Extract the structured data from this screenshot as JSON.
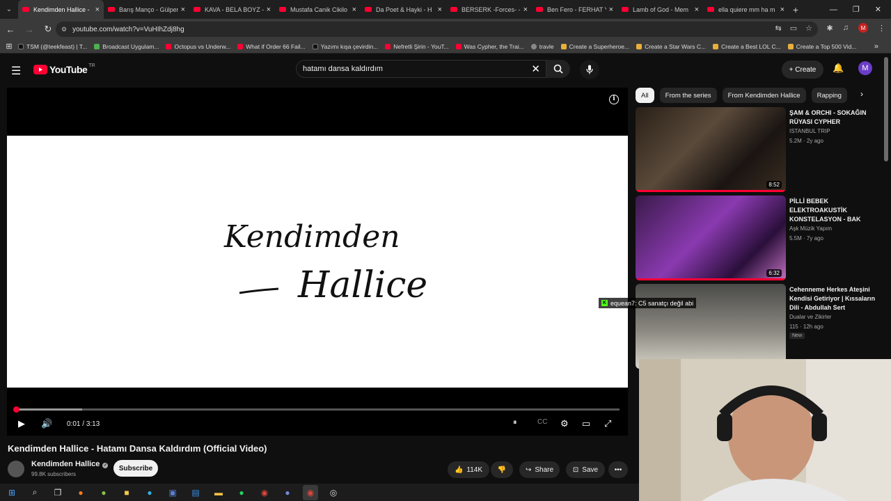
{
  "browser": {
    "tabs": [
      {
        "label": "Kendimden Hallice -",
        "active": true
      },
      {
        "label": "Barış Manço - Gülpem",
        "active": false
      },
      {
        "label": "KAVA - BELA BOYZ -",
        "active": false
      },
      {
        "label": "Mustafa Canik Cikilo",
        "active": false
      },
      {
        "label": "Da Poet & Hayki - H",
        "active": false
      },
      {
        "label": "BERSERK -Forces- - Y",
        "active": false
      },
      {
        "label": "Ben Fero - FERHAT Y",
        "active": false
      },
      {
        "label": "Lamb of God - Mem",
        "active": false
      },
      {
        "label": "ella quiere mm ha m",
        "active": false
      }
    ],
    "url": "youtube.com/watch?v=VuHIhZdj8hg",
    "profile_initial": "M",
    "bookmarks": [
      {
        "label": "TSM (@teekfeast) | T...",
        "icon": "tt"
      },
      {
        "label": "Broadcast Uygulam...",
        "icon": "green"
      },
      {
        "label": "Octopus vs Underw...",
        "icon": "yt"
      },
      {
        "label": "What if Order 66 Fail...",
        "icon": "yt"
      },
      {
        "label": "Yazımı kışa çevirdin...",
        "icon": "tt"
      },
      {
        "label": "Nefretli Şirin - YouT...",
        "icon": "yt"
      },
      {
        "label": "Was Cypher, the Trai...",
        "icon": "yt"
      },
      {
        "label": "travle",
        "icon": "globe"
      },
      {
        "label": "Create a Superheroe...",
        "icon": "doc"
      },
      {
        "label": "Create a Star Wars C...",
        "icon": "doc"
      },
      {
        "label": "Create a Best LOL C...",
        "icon": "doc"
      },
      {
        "label": "Create a Top 500 Vid...",
        "icon": "doc"
      }
    ]
  },
  "header": {
    "logo_text": "YouTube",
    "country_code": "TR",
    "search_value": "hatamı dansa kaldırdım",
    "create_label": "+ Create",
    "avatar_initial": "M"
  },
  "player": {
    "current_time": "0:01",
    "duration": "3:13",
    "played_fraction": 0.005,
    "loaded_fraction": 0.11,
    "video_text_line1": "Kendimden",
    "video_text_line2": "Hallice"
  },
  "video": {
    "title": "Kendimden Hallice - Hatamı Dansa Kaldırdım (Official Video)",
    "channel": "Kendimden Hallice",
    "subscribers": "99.8K subscribers",
    "subscribe_label": "Subscribe",
    "likes": "114K",
    "share_label": "Share",
    "save_label": "Save"
  },
  "chips": [
    "All",
    "From the series",
    "From Kendimden Hallice",
    "Rapping"
  ],
  "recommendations": [
    {
      "title": "ŞAM & ORCHI - SOKAĞIN RÜYASI CYPHER",
      "channel": "ISTANBUL TRIP",
      "meta": "5.2M · 2y ago",
      "duration": "8:52",
      "watched_fraction": 1.0
    },
    {
      "title": "PİLLİ BEBEK ELEKTROAKUSTİK KONSTELASYON - BAK",
      "channel": "Aşk Müzik Yapım",
      "meta": "5.5M · 7y ago",
      "duration": "6:32",
      "watched_fraction": 1.0
    },
    {
      "title": "Cehenneme Herkes Ateşini Kendisi Getiriyor | Kıssaların Dili - Abdullah Sert",
      "channel": "Dualar ve Zikirler",
      "meta": "115 · 12h ago",
      "badge": "New"
    }
  ],
  "chat_overlay": {
    "user": "equean7",
    "message": ": C5 sanatçı değil abi"
  }
}
